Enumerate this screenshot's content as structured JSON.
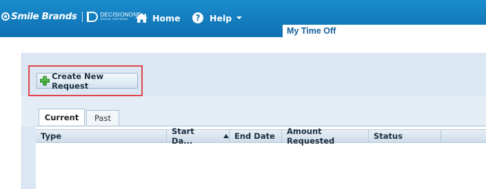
{
  "brand": {
    "name": "Smile Brands",
    "partner_name": "DECISIONONE",
    "partner_sub": "DENTAL PARTNERS"
  },
  "nav": {
    "home_label": "Home",
    "help_label": "Help",
    "home_icon": "home-icon",
    "help_icon": "help-icon"
  },
  "page": {
    "title": "My Time Off"
  },
  "actions": {
    "create_label": "Create New Request",
    "create_icon": "plus-icon"
  },
  "tabs": [
    {
      "label": "Current",
      "selected": true
    },
    {
      "label": "Past",
      "selected": false
    }
  ],
  "grid": {
    "columns": [
      {
        "label": "Type"
      },
      {
        "label": "Start Da...",
        "sort": "ascending"
      },
      {
        "label": "End Date"
      },
      {
        "label": "Amount Requested"
      },
      {
        "label": "Status"
      }
    ],
    "rows": []
  },
  "colors": {
    "topbar": "#0e70b1",
    "panel": "#dbe7f3",
    "highlight": "#e0464a",
    "plus_icon": "#3aa935"
  }
}
